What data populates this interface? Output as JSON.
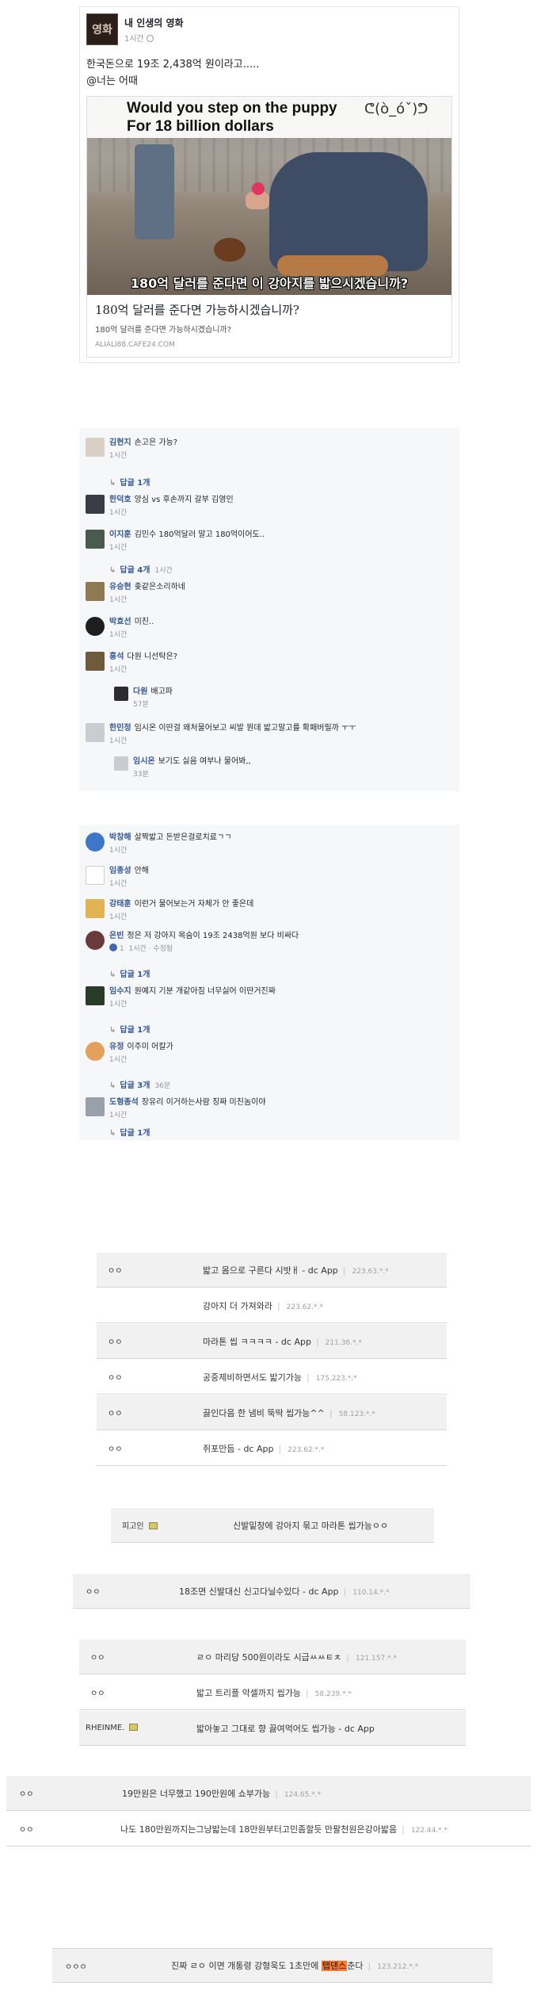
{
  "post": {
    "page_avatar_text": "영화",
    "page_name": "내 인생의 영화",
    "time": "1시간",
    "text_line1": "한국돈으로 19조 2,438억 원이라고.....",
    "text_line2": "@너는 어때",
    "image_line1": "Would you step on the puppy",
    "image_line2": "For 18 billion dollars",
    "image_emoji": "ᕦ(ò_óˇ)ᕤ",
    "image_caption": "180억 달러를 준다면 이 강아지를 밟으시겠습니까?",
    "link_title": "180억 달러를 준다면 가능하시겠습니까?",
    "link_desc": "180억 달러를 준다면 가능하시겠습니까?",
    "link_domain": "ALIALI88.CAFE24.COM"
  },
  "comments1": [
    {
      "name": "김현지",
      "text": "손고은 가능?",
      "time": "1시간",
      "reply": "답글 1개",
      "reply_time": ""
    },
    {
      "name": "한덕호",
      "text": "앙심 vs 후손까지 갈부 김영인",
      "time": "1시간"
    },
    {
      "name": "이지훈",
      "text": "김민수 180억달러 말고 180억이어도..",
      "time": "1시간",
      "reply": "답글 4개",
      "reply_time": "1시간"
    },
    {
      "name": "유승현",
      "text": "좆같은소리하네",
      "time": "1시간"
    },
    {
      "name": "박효선",
      "text": "미친..",
      "time": "1시간"
    },
    {
      "name": "홍석",
      "text": "다원 니선탁은?",
      "time": "1시간"
    },
    {
      "name": "다원",
      "text": "배고파",
      "time": "57분"
    },
    {
      "name": "한민정",
      "text": "임시온 이딴걸 왜처물어보고 씨발 뭔데 밟고말고를 확패버릴까 ㅜㅜ",
      "time": "1시간"
    },
    {
      "name": "임시온",
      "text": "보기도 싫음 여부나 물어봐,,",
      "time": "33분"
    }
  ],
  "comments2": [
    {
      "name": "박창해",
      "text": "살짝밟고 돈받은걸로치료ㄱㄱ",
      "time": "1시간"
    },
    {
      "name": "임종성",
      "text": "안해",
      "time": "1시간"
    },
    {
      "name": "강태훈",
      "text": "이런거 물어보는거 자체가 안 좋은데",
      "time": "1시간"
    },
    {
      "name": "은빈",
      "text": "정은 저 강아지 목숨이 19조 2438억원 보다 비싸다",
      "likes": "1",
      "time": "1시간 · 수정됨",
      "reply": "답글 1개"
    },
    {
      "name": "임수지",
      "text": "원예지 기분 개같아짐 너무싫어 이딴거진짜",
      "time": "1시간",
      "reply": "답글 1개"
    },
    {
      "name": "유정",
      "text": "이주미 어칼가",
      "time": "1시간",
      "reply": "답글 3개",
      "reply_time": "36분"
    },
    {
      "name": "도형종석",
      "text": "장유리 이거하는사람 징짜 미친놈이야",
      "time": "1시간",
      "reply": "답글 1개"
    }
  ],
  "dc": {
    "group1": [
      {
        "nick": "ㅇㅇ",
        "text": "밟고 몸으로 구른다 시밧ㅐ - dc App",
        "ip": "223.63.*.*"
      },
      {
        "nick": "",
        "text": "강아지 더 가져와라",
        "ip": "223.62.*.*"
      },
      {
        "nick": "ㅇㅇ",
        "text": "마라톤 씹 ㅋㅋㅋㅋ - dc App",
        "ip": "211.36.*.*"
      },
      {
        "nick": "ㅇㅇ",
        "text": "공중제비하면서도 밟기가능",
        "ip": "175.223.*.*"
      },
      {
        "nick": "ㅇㅇ",
        "text": "끓인다음 한 냄비 뚝딱 씹가능^^",
        "ip": "58.123.*.*"
      },
      {
        "nick": "ㅇㅇ",
        "text": "쥐포만듬 - dc App",
        "ip": "223.62.*.*"
      }
    ],
    "row_fisher": {
      "nick": "피고인",
      "text": "신발밑창에 강아지 묶고 마라톤 씹가능ㅇㅇ"
    },
    "row_18jo": {
      "nick": "ㅇㅇ",
      "text": "18조면 신발대신 신고다닐수있다 - dc App",
      "ip": "110.14.*.*"
    },
    "group3": [
      {
        "nick": "ㅇㅇ",
        "text": "ㄹㅇ 마리당 500원이라도 시급ㅆㅆㅌㅊ",
        "ip": "121.157.*.*"
      },
      {
        "nick": "ㅇㅇ",
        "text": "밟고 트리플 악셀까지 씹가능",
        "ip": "58.239.*.*"
      },
      {
        "nick": "RHEINME.",
        "text": "밟아놓고 그대로 향 끓여먹어도 씹가능 - dc App",
        "ip": ""
      }
    ],
    "group4": [
      {
        "nick": "ㅇㅇ",
        "text": "19만원은 너무했고 190만원에 쇼부가능",
        "ip": "124.65.*.*"
      },
      {
        "nick": "ㅇㅇ",
        "text": "나도 180만원까지는그냥밟는데 18만원부터고민좀할듯 만팔천원은강아밟음",
        "ip": "122.44.*.*"
      }
    ],
    "last": {
      "nick": "ㅇㅇㅇ",
      "text_before": "진짜 ㄹㅇ 이면 개통령 강형욱도 1초만에 ",
      "highlight": "탭댄스",
      "text_after": "춘다",
      "ip": "123.212.*.*"
    }
  }
}
